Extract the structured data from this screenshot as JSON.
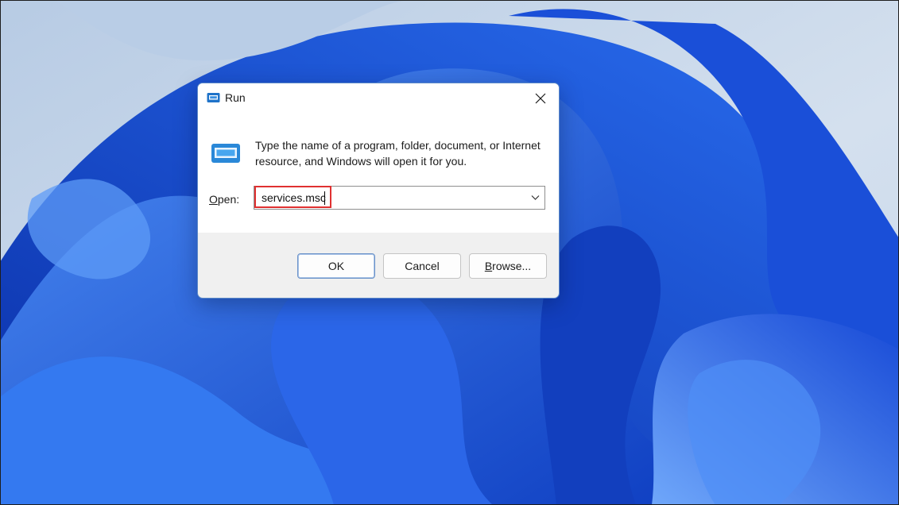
{
  "dialog": {
    "title": "Run",
    "description": "Type the name of a program, folder, document, or Internet resource, and Windows will open it for you.",
    "open_label": "Open:",
    "open_value": "services.msc"
  },
  "buttons": {
    "ok": "OK",
    "cancel": "Cancel",
    "browse": "Browse..."
  },
  "colors": {
    "wallpaper_blue": "#1f5fe0",
    "wallpaper_bg": "#c9d8ea",
    "highlight": "#e03131"
  },
  "icons": [
    "run-app-icon",
    "close-icon",
    "run-program-icon",
    "chevron-down-icon"
  ]
}
